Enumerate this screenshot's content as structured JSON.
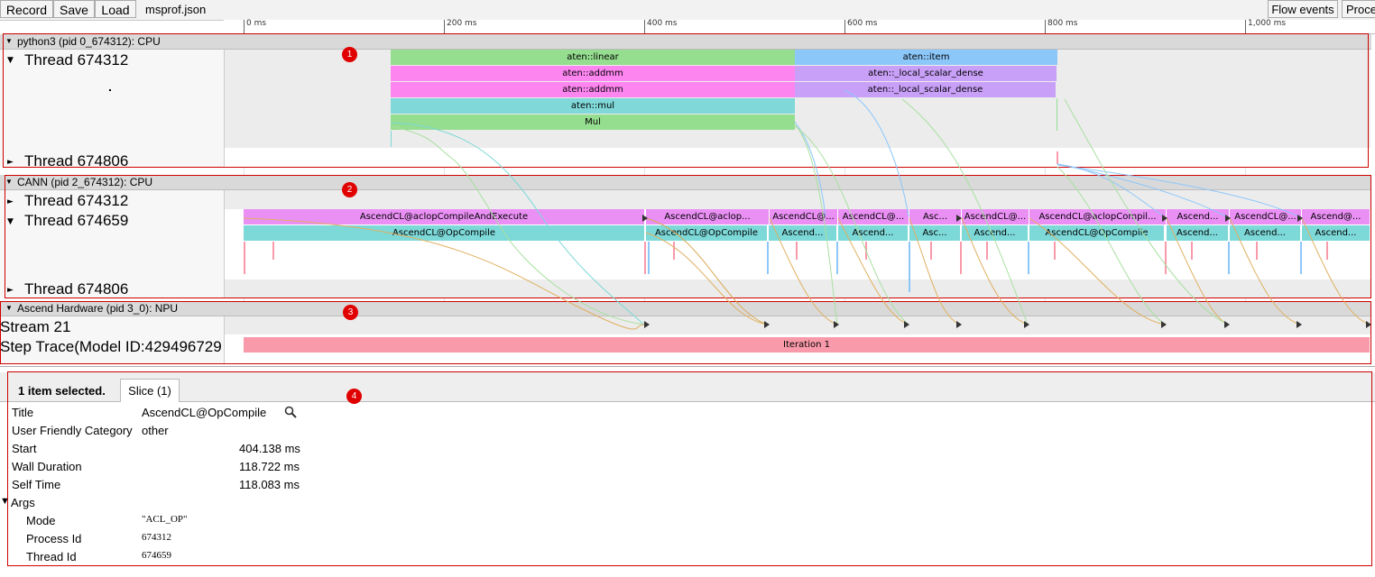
{
  "toolbar": {
    "record": "Record",
    "save": "Save",
    "load": "Load",
    "filename": "msprof.json",
    "flow_events": "Flow events",
    "process": "Proce"
  },
  "ruler": {
    "labels": [
      "0 ms",
      "200 ms",
      "400 ms",
      "600 ms",
      "800 ms",
      "1,000 ms"
    ]
  },
  "sections": {
    "python": {
      "title": "python3 (pid 0_674312): CPU",
      "thread1": "Thread 674312",
      "thread2": "Thread 674806",
      "badge": "1"
    },
    "cann": {
      "title": "CANN (pid 2_674312): CPU",
      "thread1": "Thread 674312",
      "thread2": "Thread 674659",
      "thread3": "Thread 674806",
      "badge": "2"
    },
    "npu": {
      "title": "Ascend Hardware (pid 3_0): NPU",
      "stream": "Stream 21",
      "step": "Step Trace(Model ID:429496729",
      "badge": "3"
    }
  },
  "python_slices": [
    {
      "label": "aten::linear",
      "color": "#95dd8f"
    },
    {
      "label": "aten::addmm",
      "color": "#fd85f0"
    },
    {
      "label": "aten::addmm",
      "color": "#fd85f0"
    },
    {
      "label": "aten::mul",
      "color": "#80d8d8"
    },
    {
      "label": "Mul",
      "color": "#95dd8f"
    },
    {
      "label": "aten::item",
      "color": "#8cc7fa"
    },
    {
      "label": "aten::_local_scalar_dense",
      "color": "#c9a0f8"
    },
    {
      "label": "aten::_local_scalar_dense",
      "color": "#c9a0f8"
    }
  ],
  "cann_row1": [
    {
      "label": "AscendCL@aclopCompileAndExecute",
      "color": "#ea90f5"
    },
    {
      "label": "AscendCL@aclop...",
      "color": "#ea90f5"
    },
    {
      "label": "AscendCL@...",
      "color": "#ea90f5"
    },
    {
      "label": "AscendCL@...",
      "color": "#ea90f5"
    },
    {
      "label": "Asc...",
      "color": "#ea90f5"
    },
    {
      "label": "AscendCL@...",
      "color": "#ea90f5"
    },
    {
      "label": "AscendCL@aclopCompil...",
      "color": "#ea90f5"
    },
    {
      "label": "Ascend...",
      "color": "#ea90f5"
    },
    {
      "label": "AscendCL@...",
      "color": "#ea90f5"
    },
    {
      "label": "Ascend@...",
      "color": "#ea90f5"
    }
  ],
  "cann_row2": [
    {
      "label": "AscendCL@OpCompile",
      "color": "#7dd8d8"
    },
    {
      "label": "AscendCL@OpCompile",
      "color": "#7dd8d8"
    },
    {
      "label": "Ascend...",
      "color": "#7dd8d8"
    },
    {
      "label": "Ascend...",
      "color": "#7dd8d8"
    },
    {
      "label": "Asc...",
      "color": "#7dd8d8"
    },
    {
      "label": "Ascend...",
      "color": "#7dd8d8"
    },
    {
      "label": "AscendCL@OpCompile",
      "color": "#7dd8d8"
    },
    {
      "label": "Ascend...",
      "color": "#7dd8d8"
    },
    {
      "label": "Ascend...",
      "color": "#7dd8d8"
    },
    {
      "label": "Ascend...",
      "color": "#7dd8d8"
    }
  ],
  "iteration": {
    "label": "Iteration 1",
    "color": "#f99aaa"
  },
  "detail": {
    "selected": "1 item selected.",
    "tab": "Slice (1)",
    "badge": "4",
    "rows": {
      "title_k": "Title",
      "title_v": "AscendCL@OpCompile",
      "cat_k": "User Friendly Category",
      "cat_v": "other",
      "start_k": "Start",
      "start_v": "404.138 ms",
      "wall_k": "Wall Duration",
      "wall_v": "118.722 ms",
      "self_k": "Self Time",
      "self_v": "118.083 ms",
      "args_k": "Args",
      "mode_k": "Mode",
      "mode_v": "\"ACL_OP\"",
      "pid_k": "Process Id",
      "pid_v": "674312",
      "tid_k": "Thread Id",
      "tid_v": "674659"
    }
  }
}
